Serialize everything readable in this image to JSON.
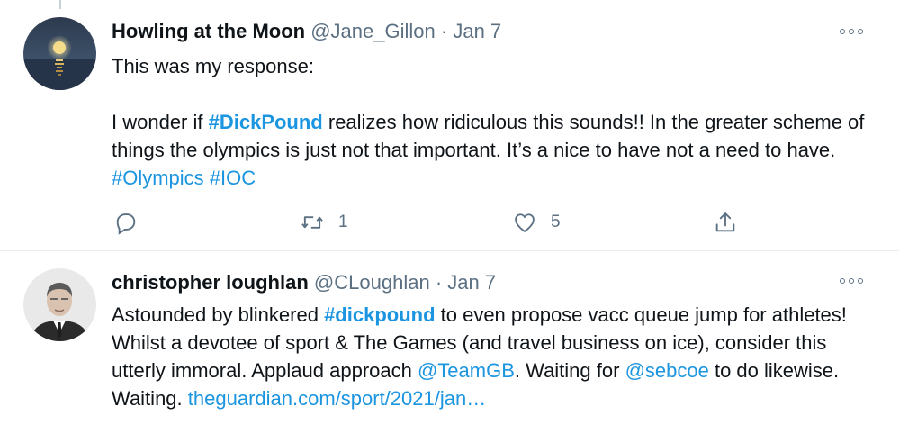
{
  "tweets": [
    {
      "display_name": "Howling at the Moon",
      "handle": "@Jane_Gillon",
      "separator": "·",
      "date": "Jan 7",
      "line1": "This was my response:",
      "body": [
        {
          "t": "I wonder if "
        },
        {
          "tag": "#DickPound",
          "bold": true
        },
        {
          "t": " realizes how ridiculous this sounds!! In the greater scheme of things the olympics is just not that important. It’s a nice to have not a need to have. "
        },
        {
          "tag": "#Olympics"
        },
        {
          "t": " "
        },
        {
          "tag": "#IOC"
        }
      ],
      "actions": {
        "replies": "",
        "retweets": "1",
        "likes": "5"
      }
    },
    {
      "display_name": "christopher loughlan",
      "handle": "@CLoughlan",
      "separator": "·",
      "date": "Jan 7",
      "body": [
        {
          "t": "Astounded by blinkered "
        },
        {
          "tag": "#dickpound",
          "bold": true
        },
        {
          "t": " to even propose vacc queue jump for athletes! Whilst a devotee of sport & The Games (and travel business on ice), consider this utterly immoral. Applaud approach "
        },
        {
          "tag": "@TeamGB"
        },
        {
          "t": ". Waiting for "
        },
        {
          "tag": "@sebcoe"
        },
        {
          "t": " to do likewise. Waiting. "
        },
        {
          "link": "theguardian.com/sport/2021/jan…"
        }
      ]
    }
  ],
  "icons": {
    "reply": "reply-icon",
    "retweet": "retweet-icon",
    "like": "heart-icon",
    "share": "share-icon",
    "more": "more-options-icon"
  },
  "colors": {
    "accent": "#1b95e0",
    "text": "#0f1419",
    "muted": "#5b7083",
    "border": "#e6ecf0"
  }
}
